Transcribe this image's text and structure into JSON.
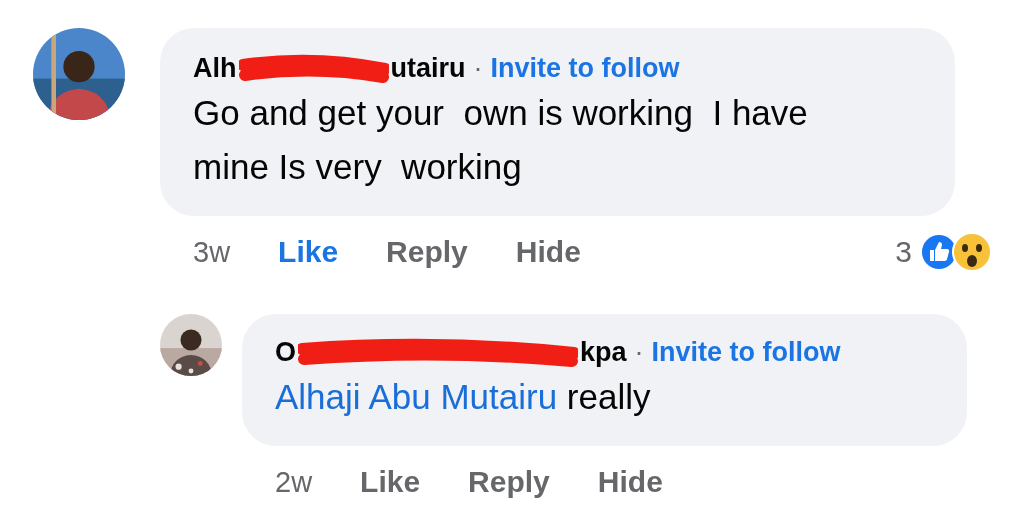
{
  "comments": [
    {
      "author_start": "Alh",
      "author_end": "utairu",
      "separator": "·",
      "follow": "Invite to follow",
      "text": "Go and get your  own is working  I have mine Is very  working",
      "time": "3w",
      "actions": [
        {
          "label": "Like",
          "selected": true
        },
        {
          "label": "Reply",
          "selected": false
        },
        {
          "label": "Hide",
          "selected": false
        }
      ],
      "reactions": {
        "count": "3"
      },
      "reply": false
    },
    {
      "author_start": "O",
      "author_end": "kpa",
      "separator": "·",
      "follow": "Invite to follow",
      "mention": "Alhaji Abu Mutairu",
      "text": "really",
      "time": "2w",
      "actions": [
        {
          "label": "Like",
          "selected": false
        },
        {
          "label": "Reply",
          "selected": false
        },
        {
          "label": "Hide",
          "selected": false
        }
      ],
      "reply": true
    }
  ]
}
